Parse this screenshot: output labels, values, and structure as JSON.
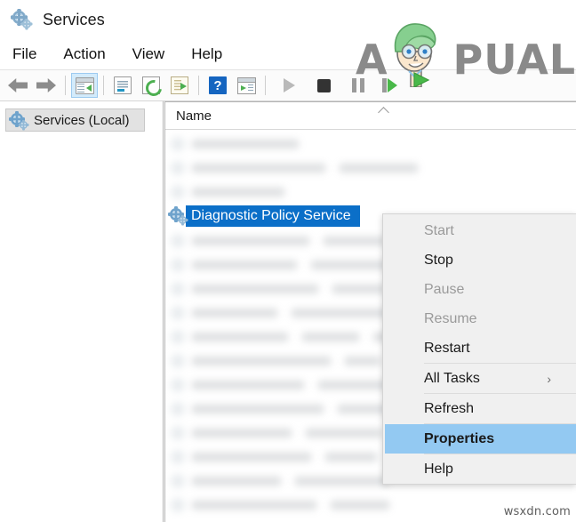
{
  "window": {
    "title": "Services",
    "title_icon": "services-gear-icon"
  },
  "menubar": {
    "items": [
      {
        "label": "File"
      },
      {
        "label": "Action"
      },
      {
        "label": "View"
      },
      {
        "label": "Help"
      }
    ]
  },
  "toolbar": {
    "buttons": [
      {
        "name": "back-icon",
        "label": "Back"
      },
      {
        "name": "forward-icon",
        "label": "Forward"
      },
      {
        "name": "show-hide-console-tree-icon",
        "label": "Show/Hide Console Tree"
      },
      {
        "name": "properties-icon",
        "label": "Properties"
      },
      {
        "name": "refresh-icon",
        "label": "Refresh"
      },
      {
        "name": "export-list-icon",
        "label": "Export List"
      },
      {
        "name": "help-icon",
        "label": "Help"
      },
      {
        "name": "show-action-pane-icon",
        "label": "Show/Hide Action Pane"
      },
      {
        "name": "start-service-icon",
        "label": "Start Service"
      },
      {
        "name": "stop-service-icon",
        "label": "Stop Service"
      },
      {
        "name": "pause-service-icon",
        "label": "Pause Service"
      },
      {
        "name": "restart-service-icon",
        "label": "Restart Service"
      }
    ],
    "help_glyph": "?"
  },
  "sidebar": {
    "items": [
      {
        "label": "Services (Local)",
        "icon": "services-gear-icon",
        "selected": true
      }
    ]
  },
  "list": {
    "columns": [
      {
        "label": "Name",
        "sorted": "ascending"
      }
    ],
    "selected_row": {
      "label": "Diagnostic Policy Service",
      "icon": "services-gear-icon"
    },
    "blurred_rows_above": 3,
    "blurred_rows_below": 12
  },
  "context_menu": {
    "items": [
      {
        "label": "Start",
        "disabled": true,
        "bold": false,
        "highlighted": false,
        "submenu": false
      },
      {
        "label": "Stop",
        "disabled": false,
        "bold": false,
        "highlighted": false,
        "submenu": false
      },
      {
        "label": "Pause",
        "disabled": true,
        "bold": false,
        "highlighted": false,
        "submenu": false
      },
      {
        "label": "Resume",
        "disabled": true,
        "bold": false,
        "highlighted": false,
        "submenu": false
      },
      {
        "label": "Restart",
        "disabled": false,
        "bold": false,
        "highlighted": false,
        "submenu": false
      },
      {
        "separator": true
      },
      {
        "label": "All Tasks",
        "disabled": false,
        "bold": false,
        "highlighted": false,
        "submenu": true,
        "submenu_glyph": "›"
      },
      {
        "separator": true
      },
      {
        "label": "Refresh",
        "disabled": false,
        "bold": false,
        "highlighted": false,
        "submenu": false
      },
      {
        "separator": true
      },
      {
        "label": "Properties",
        "disabled": false,
        "bold": true,
        "highlighted": true,
        "submenu": false
      },
      {
        "separator": true
      },
      {
        "label": "Help",
        "disabled": false,
        "bold": false,
        "highlighted": false,
        "submenu": false
      }
    ]
  },
  "watermarks": {
    "brand": "APPUALS",
    "brand_text_visible": "PUALS",
    "brand_prefix": "A",
    "site": "wsxdn.com"
  },
  "colors": {
    "selection_blue": "#0b6fc8",
    "menu_highlight_blue": "#93c9f2",
    "menu_bg": "#f0f0f0",
    "toolbar_bg": "#fbfbfb",
    "disabled_text": "#9a9a9a",
    "brand_gray": "#8a8a8a",
    "accent_green": "#4caf50"
  }
}
